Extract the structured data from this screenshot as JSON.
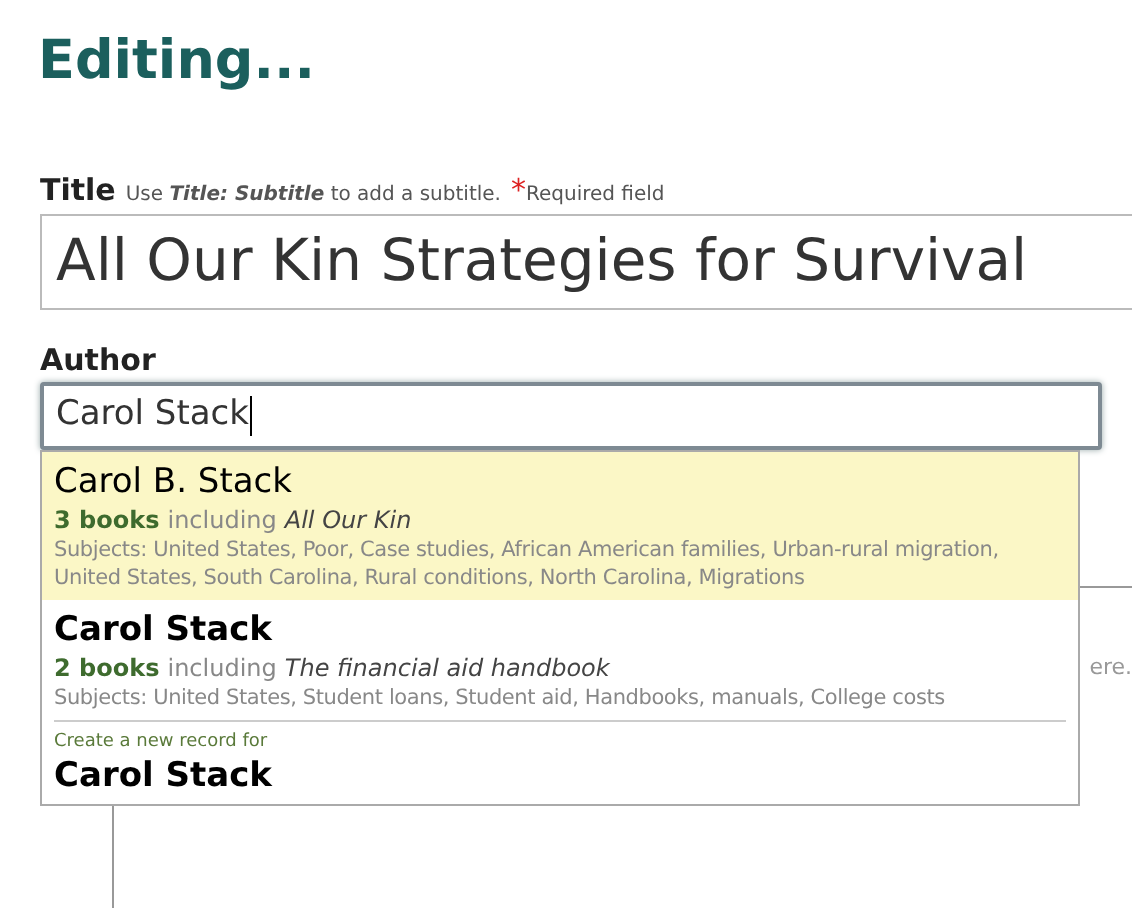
{
  "heading": "Editing...",
  "title_field": {
    "label": "Title",
    "hint_prefix": "Use ",
    "hint_example": "Title: Subtitle",
    "hint_suffix": " to add a subtitle.",
    "required_mark": "*",
    "required_text": "Required field",
    "value": "All Our Kin Strategies for Survival"
  },
  "author_field": {
    "label": "Author",
    "value": "Carol Stack"
  },
  "suggestions": [
    {
      "kind": "author",
      "name": "Carol B. Stack",
      "count": "3 books",
      "including": "including",
      "book": "All Our Kin",
      "subjects": "Subjects: United States, Poor, Case studies, African American families, Urban-rural migration, United States, South Carolina, Rural conditions, North Carolina, Migrations",
      "selected": true
    },
    {
      "kind": "author",
      "name": "Carol Stack",
      "count": "2 books",
      "including": "including",
      "book": "The financial aid handbook",
      "subjects": "Subjects: United States, Student loans, Student aid, Handbooks, manuals, College costs",
      "selected": false
    },
    {
      "kind": "create",
      "caption": "Create a new record for",
      "name": "Carol Stack",
      "selected": false
    }
  ],
  "background_text": "ere."
}
